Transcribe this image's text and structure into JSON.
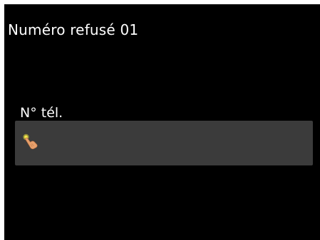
{
  "screen": {
    "title": "Numéro refusé 01",
    "background_color": "#000000",
    "text_color": "#ffffff"
  },
  "phone_field": {
    "label": "N° tél.",
    "value": "",
    "box_color": "#3b3b3b",
    "icon": "tap-finger-icon"
  }
}
